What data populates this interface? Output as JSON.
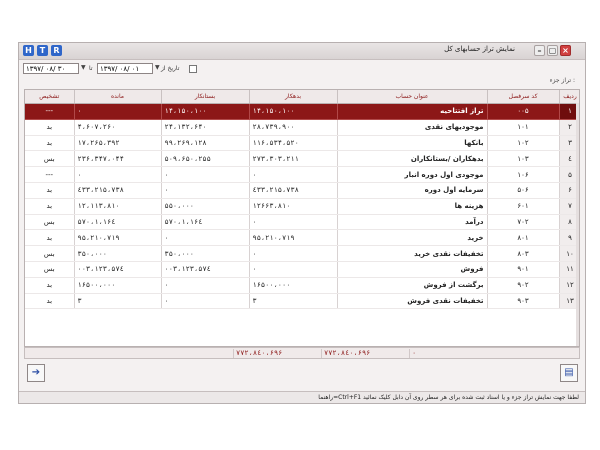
{
  "window": {
    "title": "نمایش تراز حسابهای کل",
    "letter_buttons": [
      "H",
      "T",
      "R"
    ],
    "control_glyphs": {
      "minimize": "–",
      "restore": "▢",
      "close": "×"
    }
  },
  "date_filter": {
    "from_label": "تاریخ از",
    "from_value": "۱۳۹۷/ ۰۸/ ۰۱",
    "to_label": "تا",
    "to_value": "۱۳۹۷/ ۰۸/ ۳۰"
  },
  "section": {
    "label": "تراز جزء :"
  },
  "table": {
    "headers": [
      "ردیف",
      "کد سرفصل",
      "عنوان حساب",
      "بدهکار",
      "بستانکار",
      "مانده",
      "تشخیص"
    ],
    "rows": [
      {
        "row": "۱",
        "code": "۰۰۵",
        "title": "تراز افتتاحیه",
        "debit": "۱۴،۱۵۰،۱۰۰",
        "credit": "۱۴،۱۵۰،۱۰۰",
        "balance": "۰",
        "diag": "---"
      },
      {
        "row": "۲",
        "code": "۱۰۱",
        "title": "موجودیهای نقدی",
        "debit": "۲۸،۷۳۹،۹۰۰",
        "credit": "۲۴،۱۳۲،۶۴۰",
        "balance": "۴،۶۰۷،۲۶۰",
        "diag": "بد"
      },
      {
        "row": "۳",
        "code": "۱۰۲",
        "title": "بانکها",
        "debit": "۱۱۶،۵۳۴،۵۲۰",
        "credit": "۹۹،۲۶۹،۱۲۸",
        "balance": "۱۷،۲۶۵،۳۹۲",
        "diag": "بد"
      },
      {
        "row": "٤",
        "code": "۱۰۳",
        "title": "بدهکاران /بستانکاران",
        "debit": "۲۷۳،۳۰۳،۲۱۱",
        "credit": "۵۰۹،۶۵۰،۲۵۵",
        "balance": "۲۳۶،۳۴۷،۰۴۴",
        "diag": "بس"
      },
      {
        "row": "۵",
        "code": "۱۰۶",
        "title": "موجودی اول دوره انبار",
        "debit": "۰",
        "credit": "۰",
        "balance": "۰",
        "diag": "---"
      },
      {
        "row": "۶",
        "code": "۵۰۶",
        "title": "سرمایه اول دوره",
        "debit": "۲۱۵،۷۳۸،٤۳۳",
        "credit": "۰",
        "balance": "۲۱۵،۷۳۸،٤۳۳",
        "diag": "بد"
      },
      {
        "row": "۷",
        "code": "۶۰۱",
        "title": "هزینه ها",
        "debit": "۱۲۶۶۳،۸۱۰",
        "credit": "۵۵۰،۰۰۰",
        "balance": "۱۲،۱۱۳،۸۱۰",
        "diag": "بد"
      },
      {
        "row": "۸",
        "code": "۷۰۲",
        "title": "درآمد",
        "debit": "۰",
        "credit": "۱،۱۶٤،۵۷۰",
        "balance": "۱،۱۶٤،۵۷۰",
        "diag": "بس"
      },
      {
        "row": "۹",
        "code": "۸۰۱",
        "title": "خرید",
        "debit": "۹۵،۲۱۰،۷۱۹",
        "credit": "۰",
        "balance": "۹۵،۲۱۰،۷۱۹",
        "diag": "بد"
      },
      {
        "row": "۱۰",
        "code": "۸۰۳",
        "title": "تخفیفات نقدی خرید",
        "debit": "۰",
        "credit": "۳۵۰،۰۰۰",
        "balance": "۳۵۰،۰۰۰",
        "diag": "بس"
      },
      {
        "row": "۱۱",
        "code": "۹۰۱",
        "title": "فروش",
        "debit": "۰",
        "credit": "۱۲۳،۵۷٤،۰۰۳",
        "balance": "۱۲۳،۵۷٤،۰۰۳",
        "diag": "بس"
      },
      {
        "row": "۱۲",
        "code": "۹۰۲",
        "title": "برگشت از فروش",
        "debit": "۱۶۵۰۰،۰۰۰",
        "credit": "۰",
        "balance": "۱۶۵۰۰،۰۰۰",
        "diag": "بد"
      },
      {
        "row": "۱۳",
        "code": "۹۰۳",
        "title": "تخفیفات نقدی فروش",
        "debit": "۳",
        "credit": "۰",
        "balance": "۳",
        "diag": "بد"
      }
    ]
  },
  "totals": {
    "debit": "۷۷۲،۸٤۰،۶۹۶",
    "credit": "۷۷۲،۸٤۰،۶۹۶",
    "balance": "۰"
  },
  "bottom": {
    "exit_icon_glyph": "➔",
    "report_icon_glyph": "▤"
  },
  "statusbar": {
    "text": "راهنما=Ctrl+F1 لطفا جهت نمایش تراز جزء و یا اسناد ثبت شده برای هر سطر روی آن دابل کلیک نمائید"
  }
}
